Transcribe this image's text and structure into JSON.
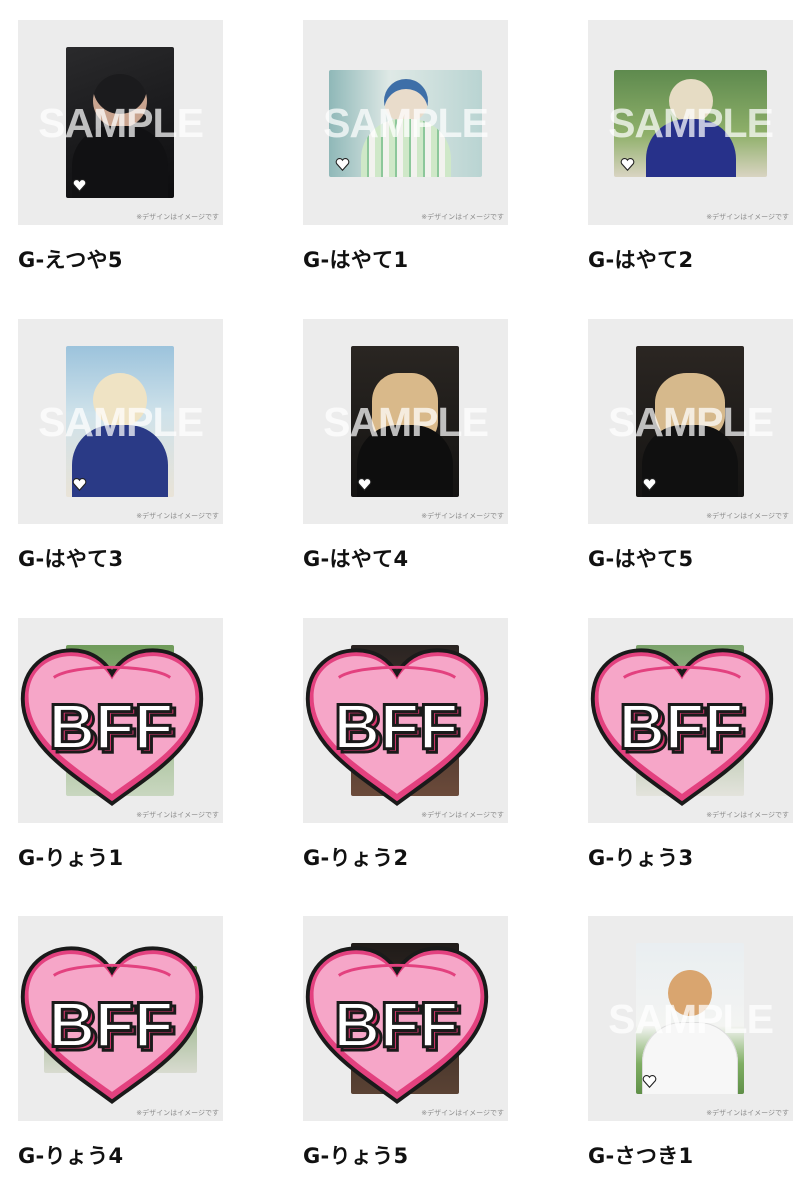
{
  "sample_label": "SAMPLE",
  "disclaimer": "※デザインはイメージです",
  "sticker_text": "BFF",
  "colors": {
    "thumb_bg": "#ececec",
    "heart_fill": "#f6a6c8",
    "heart_shadow": "#e3417f",
    "heart_outline": "#1a1a1a",
    "sticker_text_fill": "#ffffff",
    "sticker_text_shadow": "#d8366e"
  },
  "products": [
    {
      "name": "G-えつや5",
      "thumb": "sample-photo"
    },
    {
      "name": "G-はやて1",
      "thumb": "sample-photo"
    },
    {
      "name": "G-はやて2",
      "thumb": "sample-photo"
    },
    {
      "name": "G-はやて3",
      "thumb": "sample-photo"
    },
    {
      "name": "G-はやて4",
      "thumb": "sample-photo"
    },
    {
      "name": "G-はやて5",
      "thumb": "sample-photo"
    },
    {
      "name": "G-りょう1",
      "thumb": "bff-heart-sticker"
    },
    {
      "name": "G-りょう2",
      "thumb": "bff-heart-sticker"
    },
    {
      "name": "G-りょう3",
      "thumb": "bff-heart-sticker"
    },
    {
      "name": "G-りょう4",
      "thumb": "bff-heart-sticker"
    },
    {
      "name": "G-りょう5",
      "thumb": "bff-heart-sticker"
    },
    {
      "name": "G-さつき1",
      "thumb": "sample-photo"
    }
  ]
}
